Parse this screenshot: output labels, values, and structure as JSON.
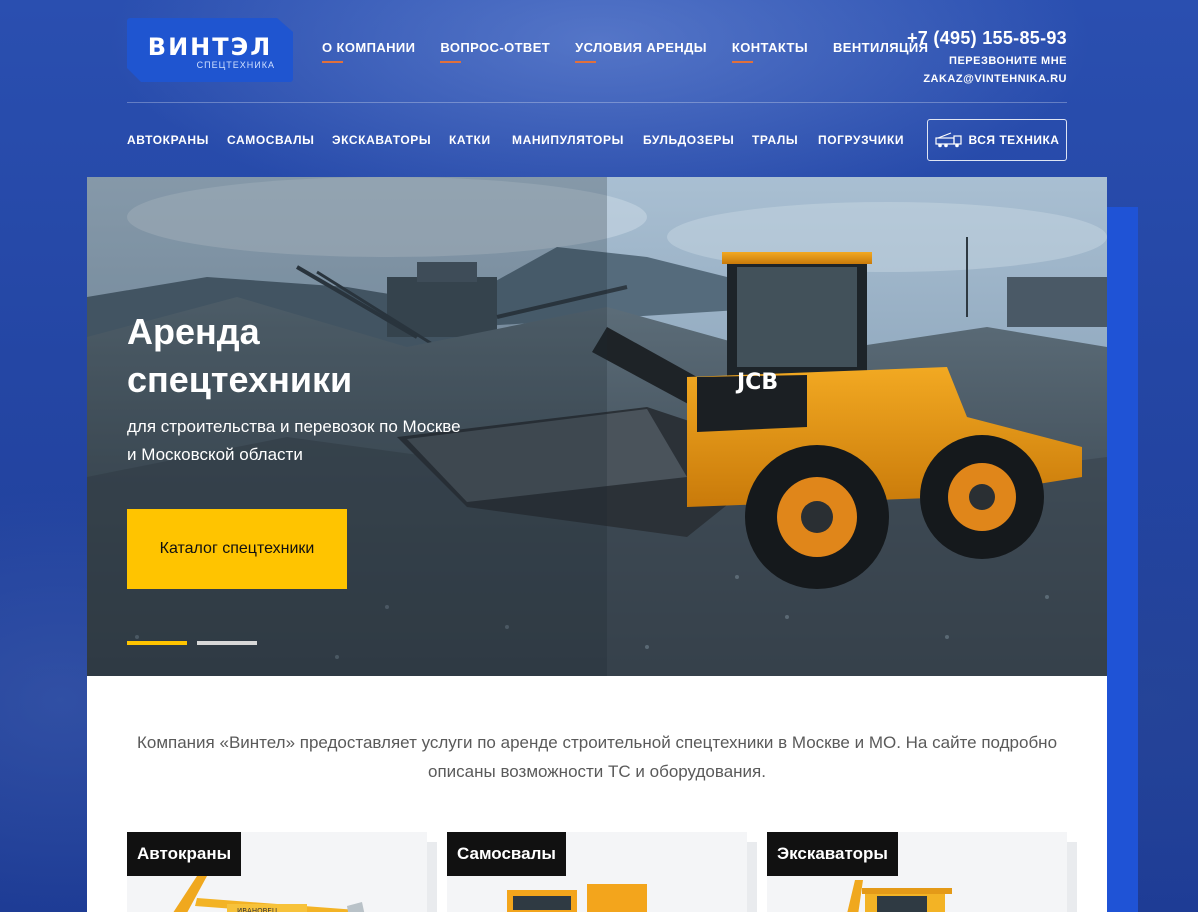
{
  "logo": {
    "title": "ВИНТЭЛ",
    "subtitle": "СПЕЦТЕХНИКА"
  },
  "main_nav": [
    {
      "label": "О КОМПАНИИ",
      "underlined": true
    },
    {
      "label": "ВОПРОС-ОТВЕТ",
      "underlined": true
    },
    {
      "label": "УСЛОВИЯ АРЕНДЫ",
      "underlined": true
    },
    {
      "label": "КОНТАКТЫ",
      "underlined": true
    },
    {
      "label": "ВЕНТИЛЯЦИЯ",
      "underlined": false
    }
  ],
  "contacts": {
    "phone": "+7 (495) 155-85-93",
    "callback": "ПЕРЕЗВОНИТЕ МНЕ",
    "email": "ZAKAZ@VINTEHNIKA.RU"
  },
  "category_nav": [
    "АВТОКРАНЫ",
    "САМОСВАЛЫ",
    "ЭКСКАВАТОРЫ",
    "КАТКИ",
    "МАНИПУЛЯТОРЫ",
    "БУЛЬДОЗЕРЫ",
    "ТРАЛЫ",
    "ПОГРУЗЧИКИ"
  ],
  "all_equipment_button": "ВСЯ ТЕХНИКА",
  "hero": {
    "title_line1": "Аренда",
    "title_line2": "спецтехники",
    "subtitle_line1": "для строительства и перевозок по Москве",
    "subtitle_line2": "и Московской области",
    "button": "Каталог спецтехники",
    "slides_total": 2,
    "slide_active": 1,
    "machine_brand": "JCB"
  },
  "intro_text": "Компания «Винтел» предоставляет услуги по аренде строительной спецтехники в Москве и МО. На сайте подробно описаны возможности ТС и оборудования.",
  "cards": [
    {
      "label": "Автокраны"
    },
    {
      "label": "Самосвалы"
    },
    {
      "label": "Экскаваторы"
    }
  ],
  "colors": {
    "brand_blue": "#1f55d0",
    "accent_yellow": "#ffc400",
    "nav_underline": "#e0703c"
  }
}
